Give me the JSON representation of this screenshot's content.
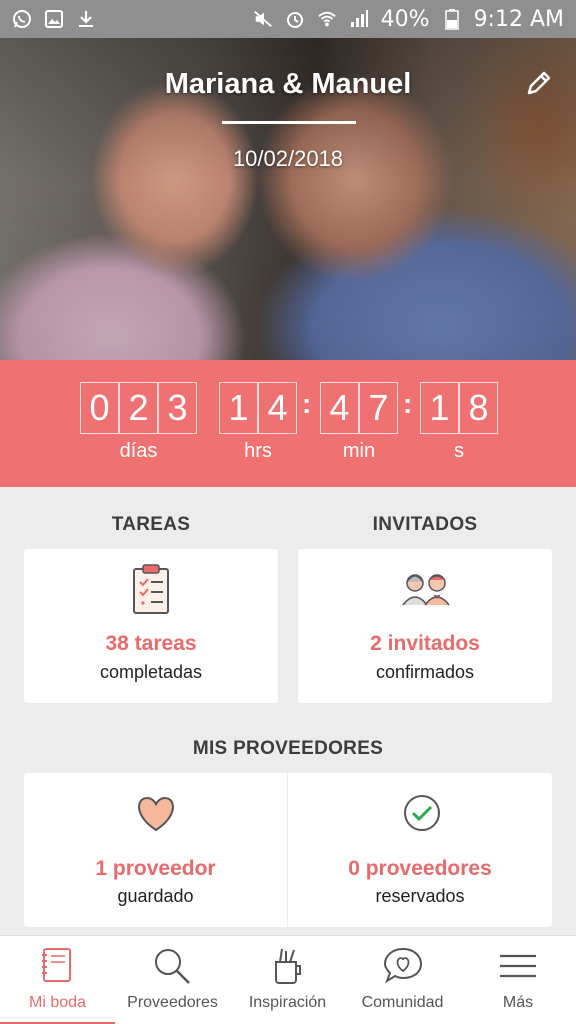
{
  "status_bar": {
    "battery": "40%",
    "time": "9:12 AM"
  },
  "hero": {
    "couple": "Mariana & Manuel",
    "date": "10/02/2018"
  },
  "countdown": {
    "days": [
      "0",
      "2",
      "3"
    ],
    "hours": [
      "1",
      "4"
    ],
    "minutes": [
      "4",
      "7"
    ],
    "seconds": [
      "1",
      "8"
    ],
    "labels": {
      "days": "días",
      "hours": "hrs",
      "minutes": "min",
      "seconds": "s"
    }
  },
  "tasks": {
    "title": "TAREAS",
    "count": "38 tareas",
    "sub": "completadas"
  },
  "guests": {
    "title": "INVITADOS",
    "count": "2 invitados",
    "sub": "confirmados"
  },
  "providers": {
    "title": "MIS PROVEEDORES",
    "saved_count": "1 proveedor",
    "saved_sub": "guardado",
    "booked_count": "0 proveedores",
    "booked_sub": "reservados"
  },
  "nav": [
    {
      "label": "Mi boda",
      "icon": "notebook-icon"
    },
    {
      "label": "Proveedores",
      "icon": "search-icon"
    },
    {
      "label": "Inspiración",
      "icon": "pencil-cup-icon"
    },
    {
      "label": "Comunidad",
      "icon": "chat-heart-icon"
    },
    {
      "label": "Más",
      "icon": "menu-icon"
    }
  ],
  "colors": {
    "accent": "#f07171",
    "accent_text": "#e96a6a",
    "status_bar": "#8f8f8f",
    "background": "#ececec"
  }
}
